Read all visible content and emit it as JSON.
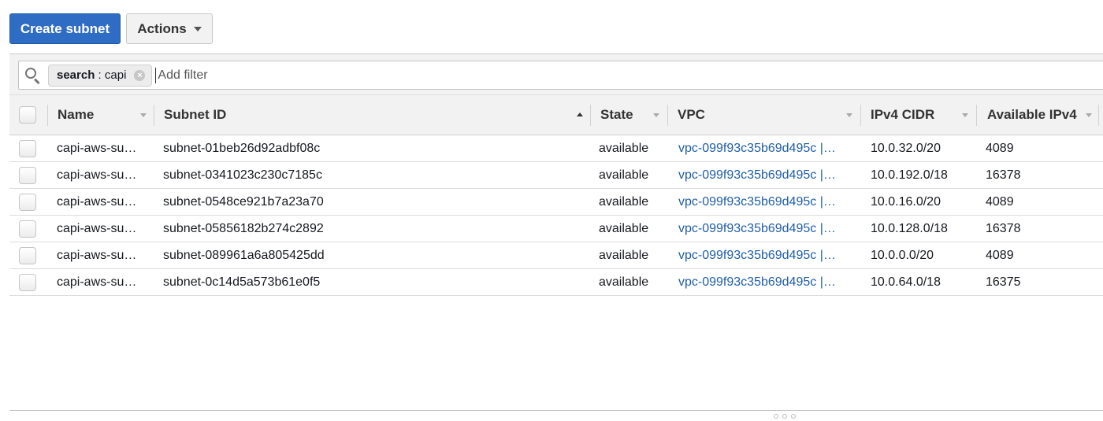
{
  "toolbar": {
    "create_label": "Create subnet",
    "actions_label": "Actions"
  },
  "filter": {
    "token_key": "search",
    "token_separator": " : ",
    "token_value": "capi",
    "placeholder": "Add filter"
  },
  "table": {
    "columns": [
      "Name",
      "Subnet ID",
      "State",
      "VPC",
      "IPv4 CIDR",
      "Available IPv4"
    ],
    "sorted_column": "Subnet ID",
    "rows": [
      {
        "name": "capi-aws-su…",
        "subnet_id": "subnet-01beb26d92adbf08c",
        "state": "available",
        "vpc": "vpc-099f93c35b69d495c |…",
        "cidr": "10.0.32.0/20",
        "available_ipv4": "4089"
      },
      {
        "name": "capi-aws-su…",
        "subnet_id": "subnet-0341023c230c7185c",
        "state": "available",
        "vpc": "vpc-099f93c35b69d495c |…",
        "cidr": "10.0.192.0/18",
        "available_ipv4": "16378"
      },
      {
        "name": "capi-aws-su…",
        "subnet_id": "subnet-0548ce921b7a23a70",
        "state": "available",
        "vpc": "vpc-099f93c35b69d495c |…",
        "cidr": "10.0.16.0/20",
        "available_ipv4": "4089"
      },
      {
        "name": "capi-aws-su…",
        "subnet_id": "subnet-05856182b274c2892",
        "state": "available",
        "vpc": "vpc-099f93c35b69d495c |…",
        "cidr": "10.0.128.0/18",
        "available_ipv4": "16378"
      },
      {
        "name": "capi-aws-su…",
        "subnet_id": "subnet-089961a6a805425dd",
        "state": "available",
        "vpc": "vpc-099f93c35b69d495c |…",
        "cidr": "10.0.0.0/20",
        "available_ipv4": "4089"
      },
      {
        "name": "capi-aws-su…",
        "subnet_id": "subnet-0c14d5a573b61e0f5",
        "state": "available",
        "vpc": "vpc-099f93c35b69d495c |…",
        "cidr": "10.0.64.0/18",
        "available_ipv4": "16375"
      }
    ]
  },
  "colors": {
    "primary_button": "#2f6cc4",
    "link": "#1f5ea8",
    "header_bg": "#f2f2f2"
  },
  "icons": [
    "search-icon",
    "chevron-down-icon",
    "clear-token-icon",
    "sort-ascending-icon",
    "resize-handle-icon"
  ]
}
